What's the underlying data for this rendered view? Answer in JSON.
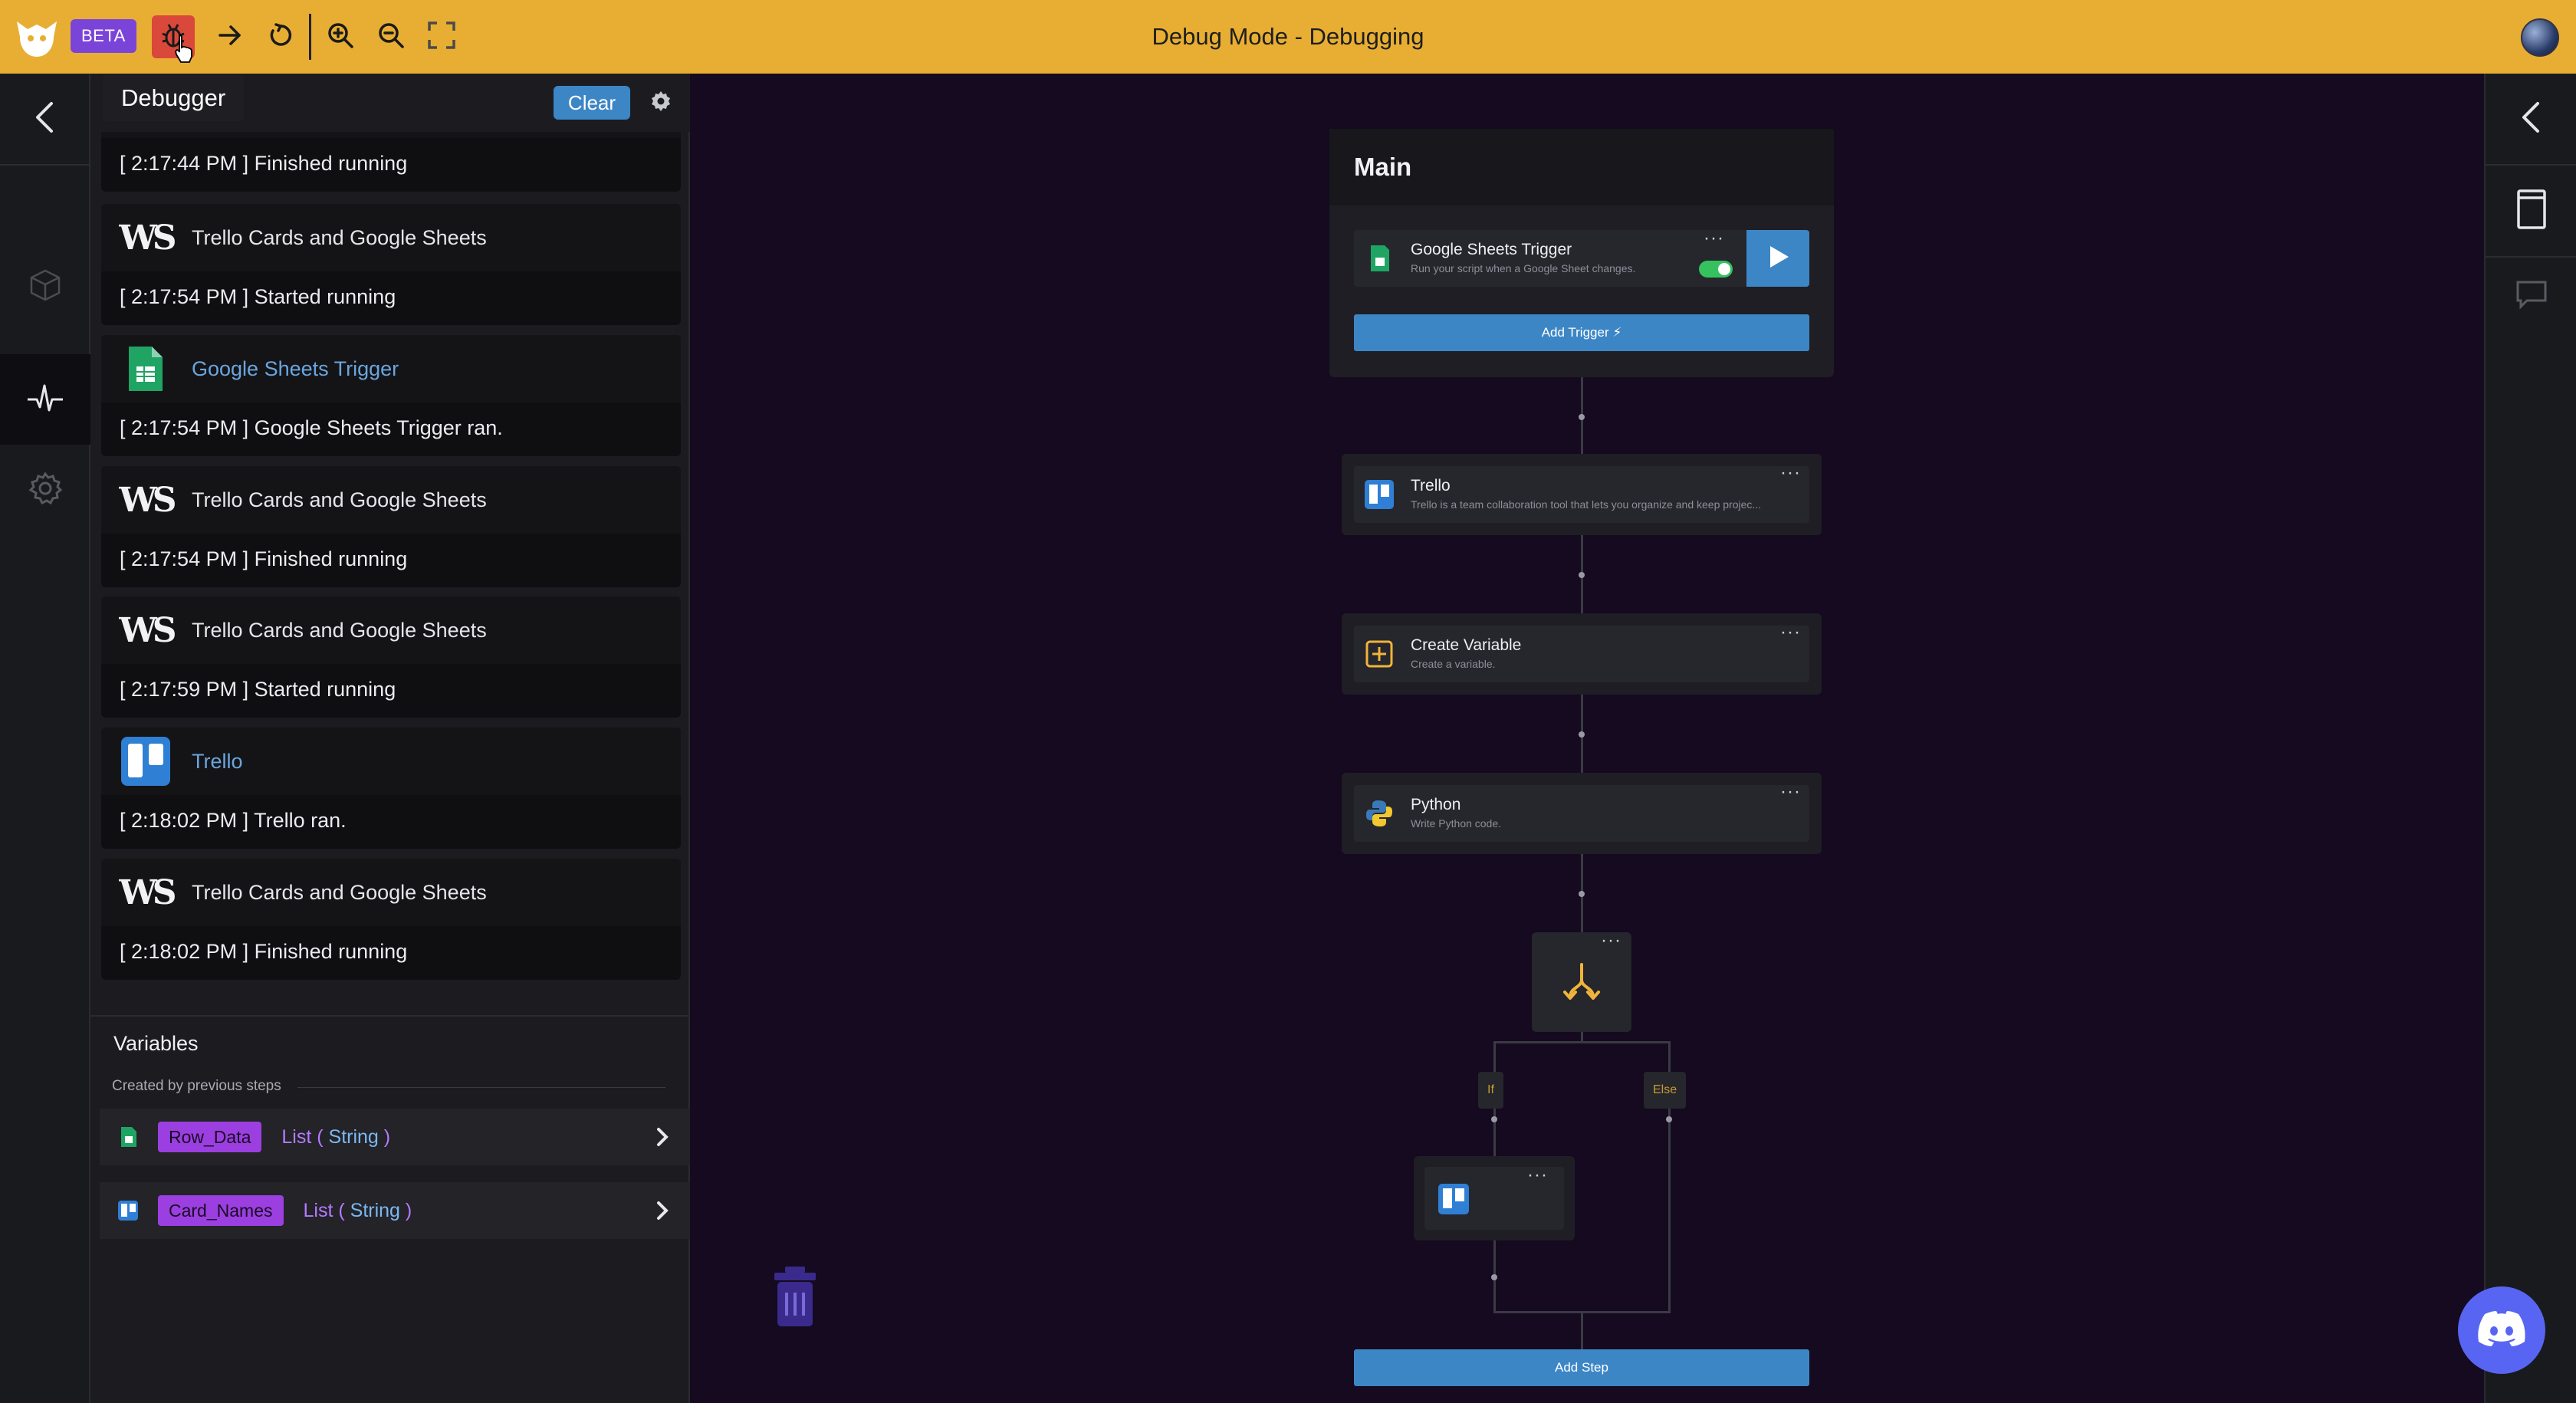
{
  "topbar": {
    "beta_label": "BETA",
    "title": "Debug Mode - Debugging",
    "tooltip": "Debugger",
    "colors": {
      "bar": "#e8ae33",
      "beta": "#7b44d8",
      "active_btn": "#d9483a"
    }
  },
  "toolbar": {
    "buttons": [
      "debugger-icon",
      "step-forward-icon",
      "restart-icon",
      "zoom-in-icon",
      "zoom-out-icon",
      "fit-screen-icon"
    ]
  },
  "left_rail": {
    "items": [
      "back-icon",
      "packages-icon",
      "edit-icon",
      "activity-icon",
      "settings-icon"
    ]
  },
  "debug_panel": {
    "clear_label": "Clear",
    "partial_log_message": "[ 2:17:44 PM ] Finished running",
    "logs": [
      {
        "icon": "ws-logo",
        "name": "Trello Cards and Google Sheets",
        "message": "[ 2:17:54 PM ] Started running",
        "link": false
      },
      {
        "icon": "google-sheets-icon",
        "name": "Google Sheets Trigger",
        "message": "[ 2:17:54 PM ] Google Sheets Trigger ran.",
        "link": true
      },
      {
        "icon": "ws-logo",
        "name": "Trello Cards and Google Sheets",
        "message": "[ 2:17:54 PM ] Finished running",
        "link": false
      },
      {
        "icon": "ws-logo",
        "name": "Trello Cards and Google Sheets",
        "message": "[ 2:17:59 PM ] Started running",
        "link": false
      },
      {
        "icon": "trello-icon",
        "name": "Trello",
        "message": "[ 2:18:02 PM ] Trello ran.",
        "link": true
      },
      {
        "icon": "ws-logo",
        "name": "Trello Cards and Google Sheets",
        "message": "[ 2:18:02 PM ] Finished running",
        "link": false
      }
    ],
    "ws_logo_text": "WS"
  },
  "variables": {
    "title": "Variables",
    "subtitle": "Created by previous steps",
    "items": [
      {
        "icon": "google-sheets-icon",
        "name": "Row_Data",
        "type": "List",
        "inner": "String"
      },
      {
        "icon": "trello-icon",
        "name": "Card_Names",
        "type": "List",
        "inner": "String"
      }
    ]
  },
  "canvas": {
    "main_title": "Main",
    "trigger": {
      "title": "Google Sheets Trigger",
      "desc": "Run your script when a Google Sheet changes.",
      "enabled": true
    },
    "add_trigger_label": "Add Trigger",
    "nodes": [
      {
        "icon": "trello-icon",
        "title": "Trello",
        "desc": "Trello is a team collaboration tool that lets you organize and keep projec..."
      },
      {
        "icon": "create-variable-icon",
        "title": "Create Variable",
        "desc": "Create a variable."
      },
      {
        "icon": "python-icon",
        "title": "Python",
        "desc": "Write Python code."
      }
    ],
    "branch": {
      "if_label": "If",
      "else_label": "Else"
    },
    "add_step_label": "Add Step",
    "dots": "···"
  },
  "right_rail": {
    "items": [
      "collapse-left-icon",
      "document-icon",
      "comment-icon"
    ]
  }
}
